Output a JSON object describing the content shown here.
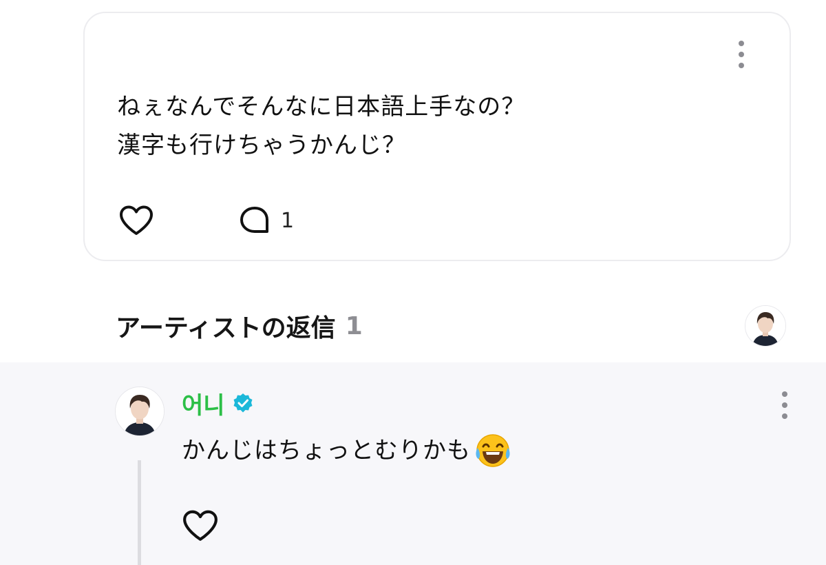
{
  "post": {
    "text_lines": [
      "ねぇなんでそんなに日本語上手なの？",
      "漢字も行けちゃうかんじ？"
    ],
    "comment_count": "1",
    "icons": {
      "more": "more-vertical-icon",
      "like": "heart-outline-icon",
      "comment": "speech-bubble-icon"
    }
  },
  "replies": {
    "title": "アーティストの返信",
    "count": "1",
    "items": [
      {
        "author": "어니",
        "verified": true,
        "text": "かんじはちょっとむりかも",
        "emoji": "face-with-tears-of-joy-icon"
      }
    ]
  },
  "colors": {
    "author_name": "#2cbf47",
    "verified_badge": "#1bb8d9",
    "reply_background": "#f7f7fa",
    "card_border": "#ececef",
    "muted_count": "#8e8e93"
  }
}
